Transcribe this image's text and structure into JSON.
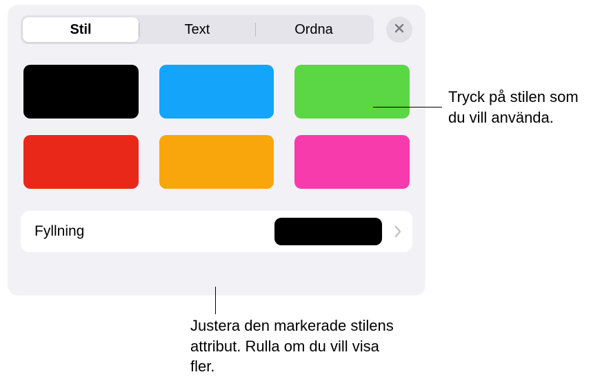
{
  "tabs": {
    "stil": "Stil",
    "text": "Text",
    "ordna": "Ordna"
  },
  "swatches": [
    {
      "name": "black",
      "color": "#000000"
    },
    {
      "name": "blue",
      "color": "#14a4fa"
    },
    {
      "name": "green",
      "color": "#5bd645"
    },
    {
      "name": "red",
      "color": "#e9281a"
    },
    {
      "name": "orange",
      "color": "#f9a60d"
    },
    {
      "name": "pink",
      "color": "#f73bad"
    }
  ],
  "fill": {
    "label": "Fyllning",
    "swatch_color": "#000000"
  },
  "callouts": {
    "top": "Tryck på stilen som du vill använda.",
    "bottom": "Justera den markerade stilens attribut. Rulla om du vill visa fler."
  }
}
